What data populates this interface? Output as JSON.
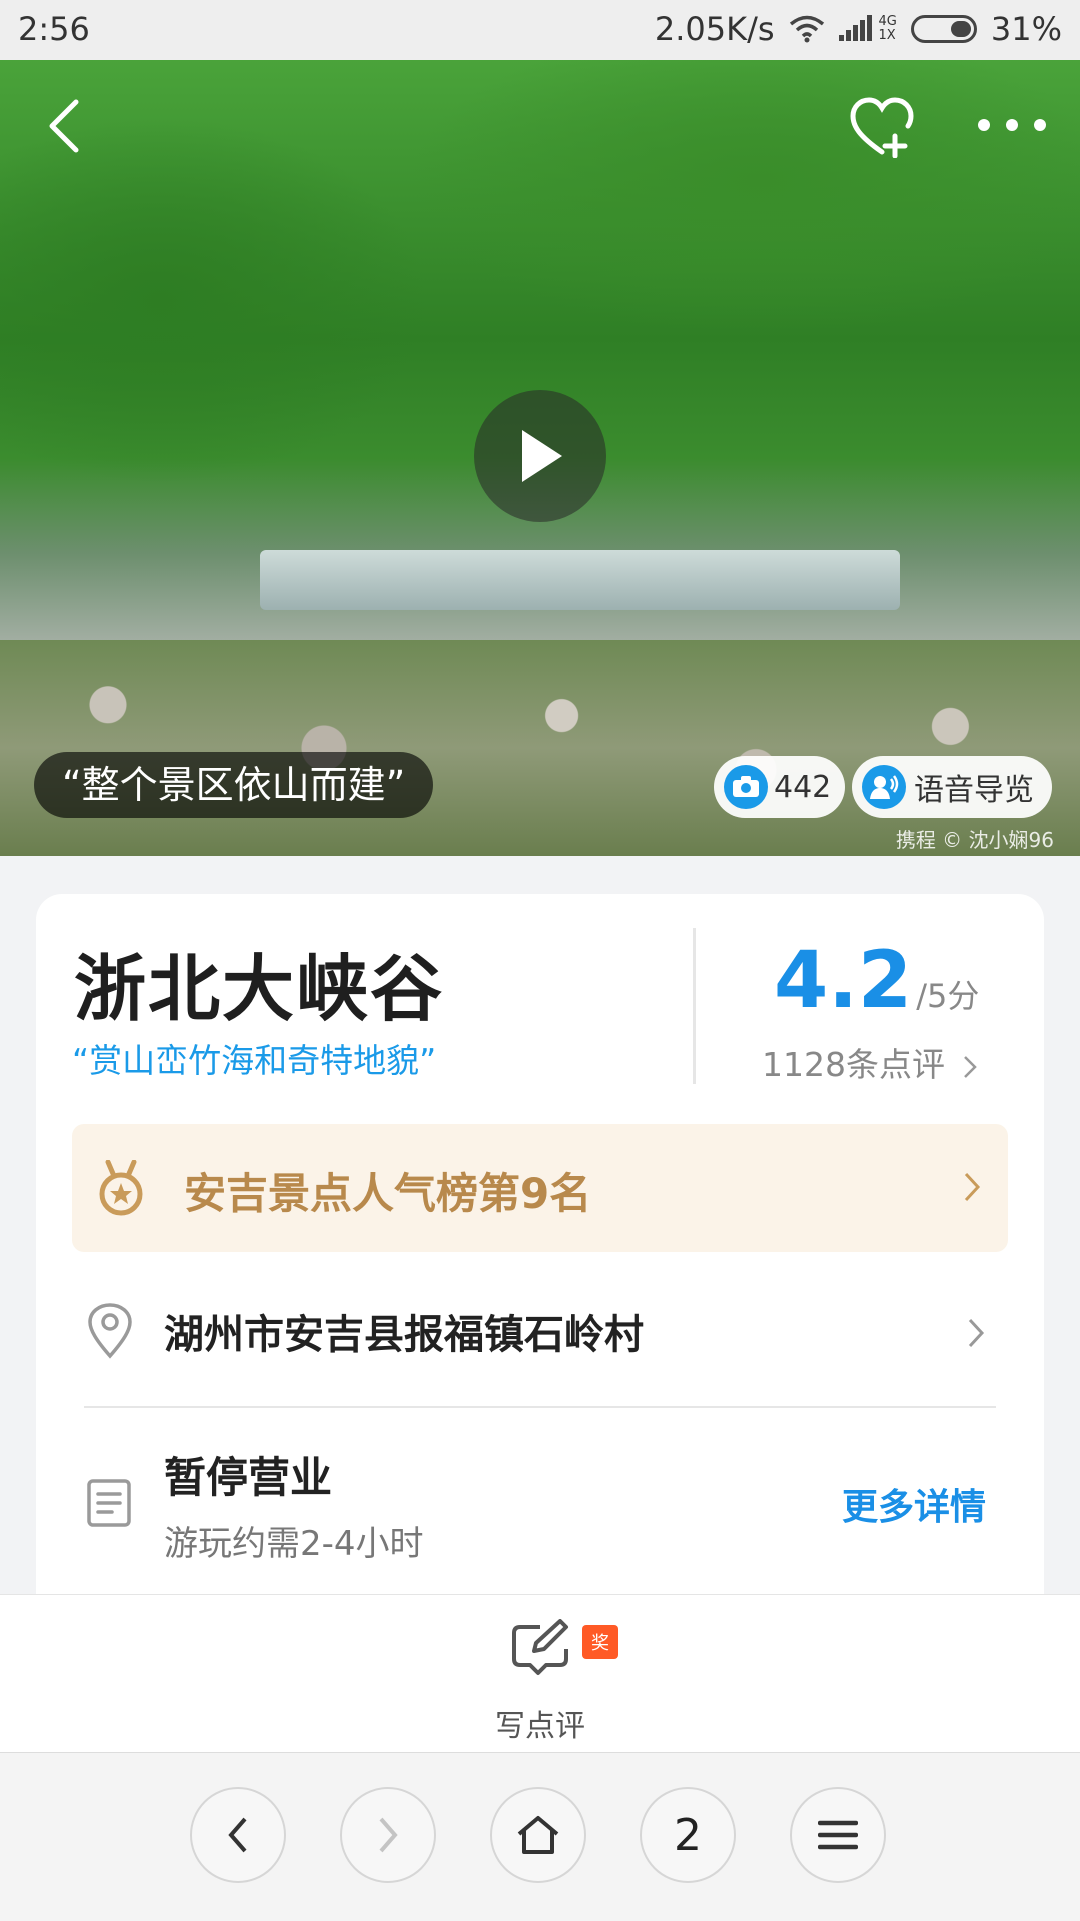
{
  "status_bar": {
    "time": "2:56",
    "speed": "2.05K/s",
    "network_small_top": "4G",
    "network_small_bottom": "1X",
    "battery": "31%"
  },
  "hero": {
    "caption": "“整个景区依山而建”",
    "photo_count": "442",
    "audio_guide": "语音导览",
    "credit": "携程 © 沈小娴96"
  },
  "attraction": {
    "name": "浙北大峡谷",
    "tagline": "“赏山峦竹海和奇特地貌”",
    "score": "4.2",
    "score_unit": "/5分",
    "reviews": "1128条点评"
  },
  "ranking": {
    "label": "安吉景点人气榜第9名"
  },
  "address": {
    "text": "湖州市安吉县报福镇石岭村"
  },
  "hours": {
    "status": "暂停营业",
    "duration": "游玩约需2-4小时",
    "more": "更多详情"
  },
  "write_review": {
    "label": "写点评",
    "badge": "奖"
  },
  "browser_nav": {
    "tab_count": "2"
  },
  "colors": {
    "accent": "#1a8fe6",
    "gold": "#b8894c",
    "badge": "#ff5a26"
  }
}
